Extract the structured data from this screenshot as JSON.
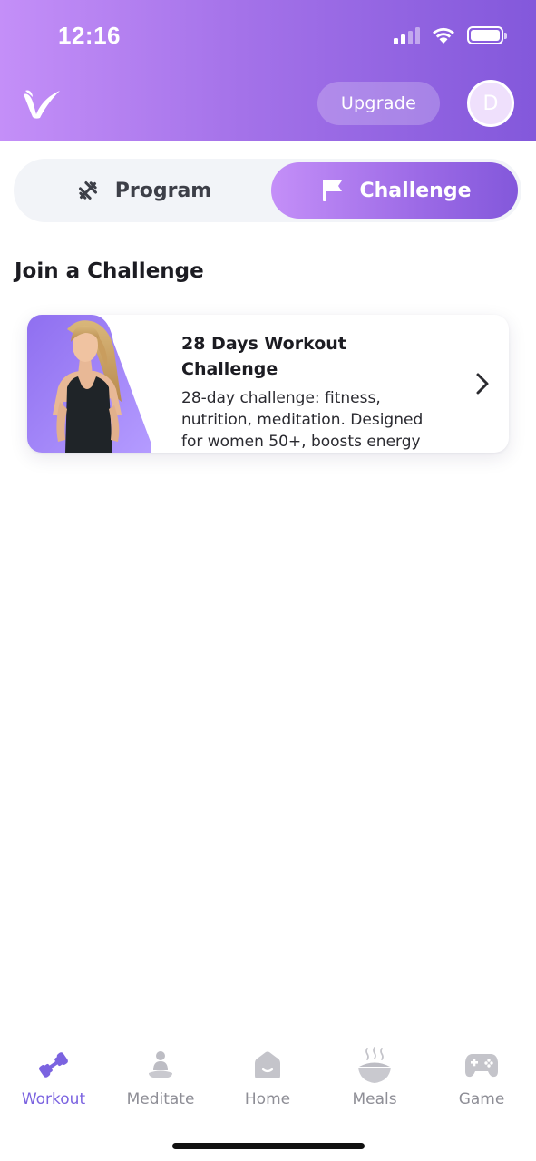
{
  "status_bar": {
    "time": "12:16"
  },
  "header": {
    "upgrade_label": "Upgrade",
    "avatar_initial": "D"
  },
  "tabs": [
    {
      "label": "Program",
      "icon": "dumbbell-icon",
      "selected": false
    },
    {
      "label": "Challenge",
      "icon": "flag-icon",
      "selected": true
    }
  ],
  "section_title": "Join a Challenge",
  "challenge_card": {
    "title_line1": "28 Days Workout",
    "title_line2": "Challenge",
    "description": "28-day challenge: fitness, nutrition, meditation. Designed for women 50+, boosts energy"
  },
  "bottom_nav": [
    {
      "label": "Workout",
      "icon": "dumbbell-icon",
      "active": true
    },
    {
      "label": "Meditate",
      "icon": "meditation-icon",
      "active": false
    },
    {
      "label": "Home",
      "icon": "home-icon",
      "active": false
    },
    {
      "label": "Meals",
      "icon": "bowl-icon",
      "active": false
    },
    {
      "label": "Game",
      "icon": "gamepad-icon",
      "active": false
    }
  ],
  "colors": {
    "accent": "#8358db",
    "accent_light": "#c48ff8",
    "nav_active": "#7b63e0",
    "nav_inactive": "#8e8e96"
  }
}
